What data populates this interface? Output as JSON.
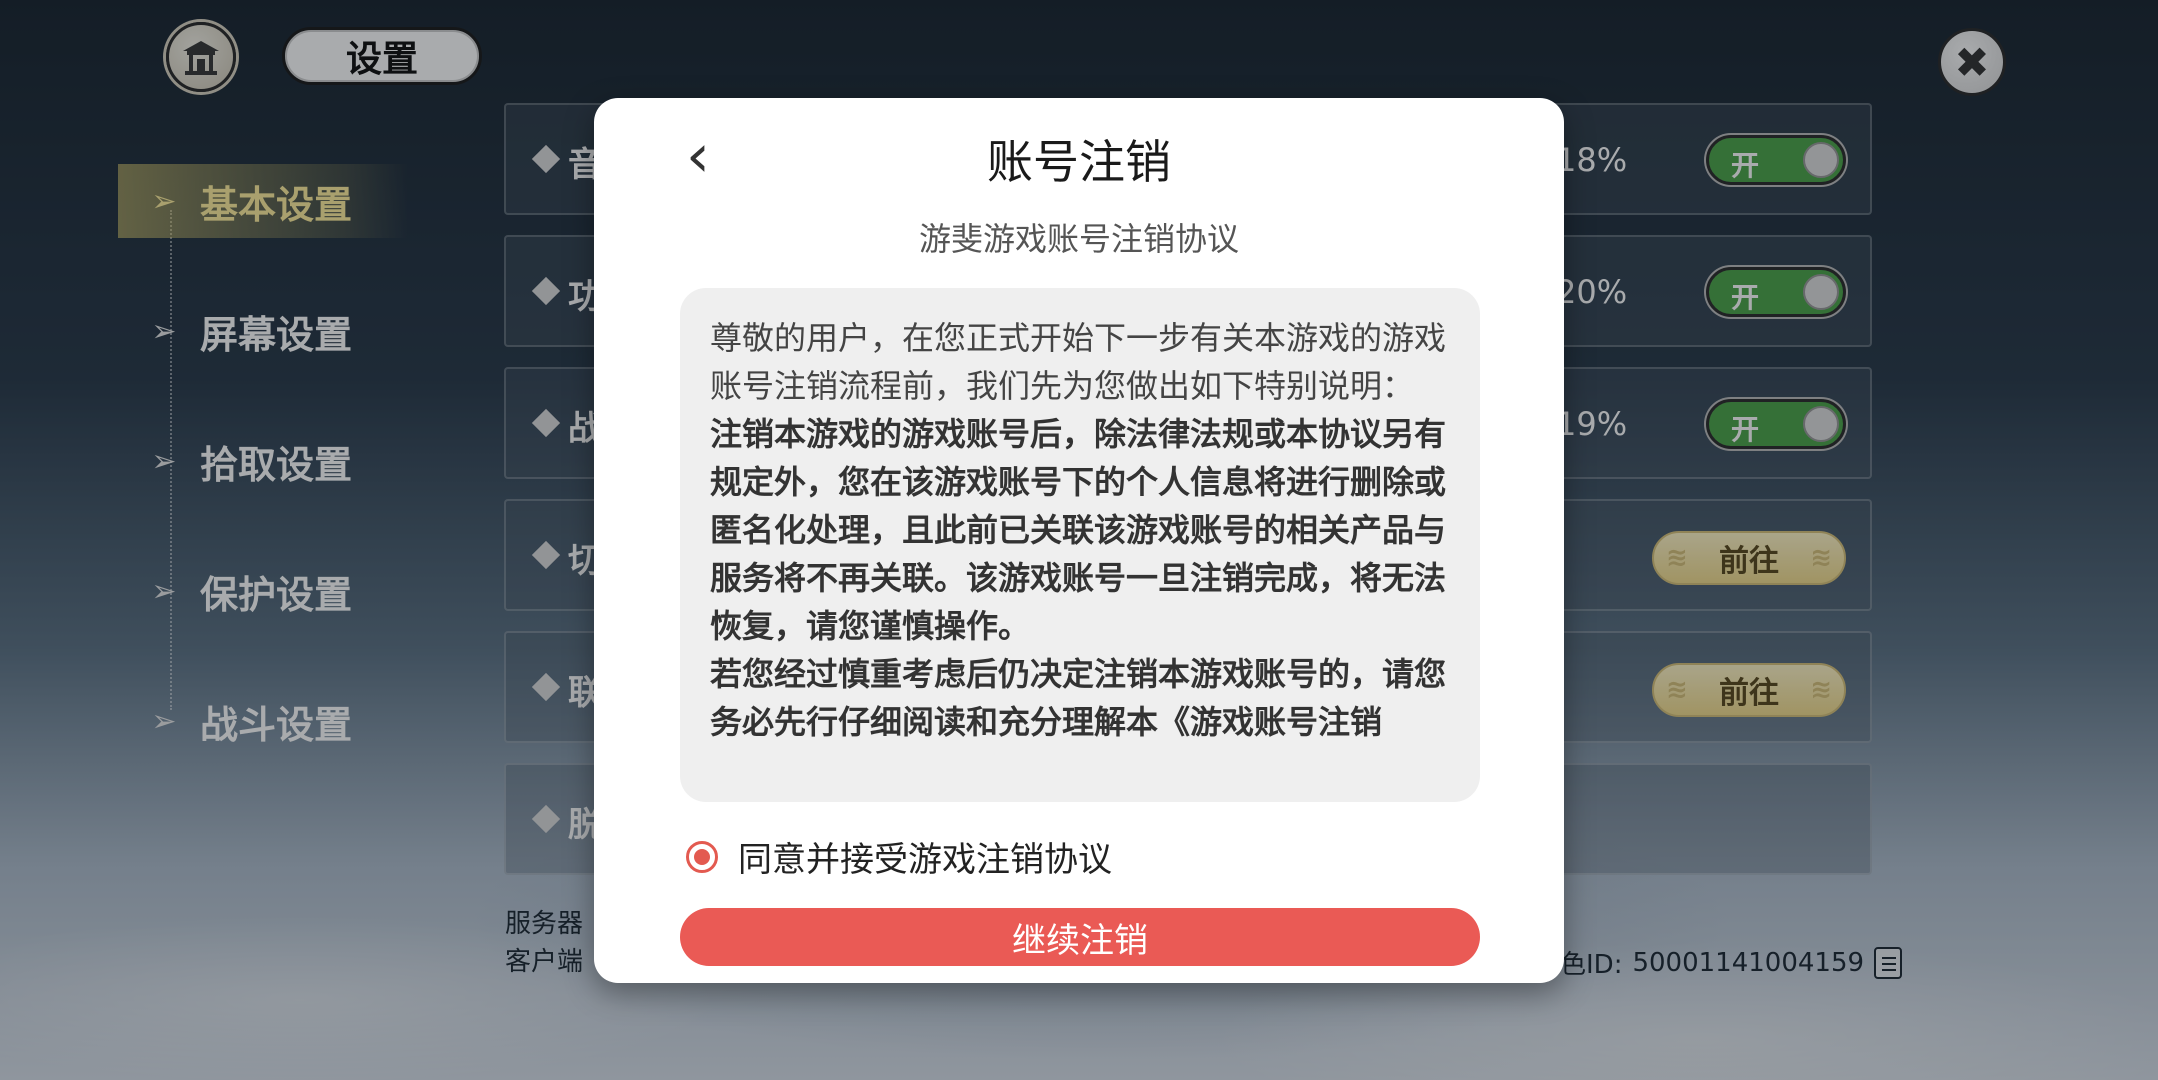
{
  "header": {
    "title": "设置",
    "home_icon": "pavilion-icon",
    "close_icon": "close-icon"
  },
  "sidebar": {
    "items": [
      {
        "label": "基本设置",
        "active": true
      },
      {
        "label": "屏幕设置",
        "active": false
      },
      {
        "label": "拾取设置",
        "active": false
      },
      {
        "label": "保护设置",
        "active": false
      },
      {
        "label": "战斗设置",
        "active": false
      }
    ]
  },
  "rows": [
    {
      "label": "音",
      "percent": "18%",
      "toggle": "开"
    },
    {
      "label": "功",
      "percent": "20%",
      "toggle": "开"
    },
    {
      "label": "战",
      "percent": "19%",
      "toggle": "开"
    },
    {
      "label": "切",
      "button": "前往"
    },
    {
      "label": "联",
      "button": "前往"
    },
    {
      "label": "脱"
    }
  ],
  "footer": {
    "line1": "服务器",
    "line2": "客户端",
    "role_id_label": "色ID:",
    "role_id": "50001141004159"
  },
  "modal": {
    "title": "账号注销",
    "subtitle": "游斐游戏账号注销协议",
    "intro": "尊敬的用户，在您正式开始下一步有关本游戏的游戏账号注销流程前，我们先为您做出如下特别说明：",
    "bold1": "注销本游戏的游戏账号后，除法律法规或本协议另有规定外，您在该游戏账号下的个人信息将进行删除或匿名化处理，且此前已关联该游戏账号的相关产品与服务将不再关联。该游戏账号一旦注销完成，将无法恢复，请您谨慎操作。",
    "bold2": "若您经过慎重考虑后仍决定注销本游戏账号的，请您务必先行仔细阅读和充分理解本《游戏账号注销",
    "agree_label": "同意并接受游戏注销协议",
    "continue_label": "继续注销"
  },
  "colors": {
    "toggle_on": "#4da54a",
    "accent_red": "#ea5a55",
    "active_nav": "#ffef9e"
  }
}
